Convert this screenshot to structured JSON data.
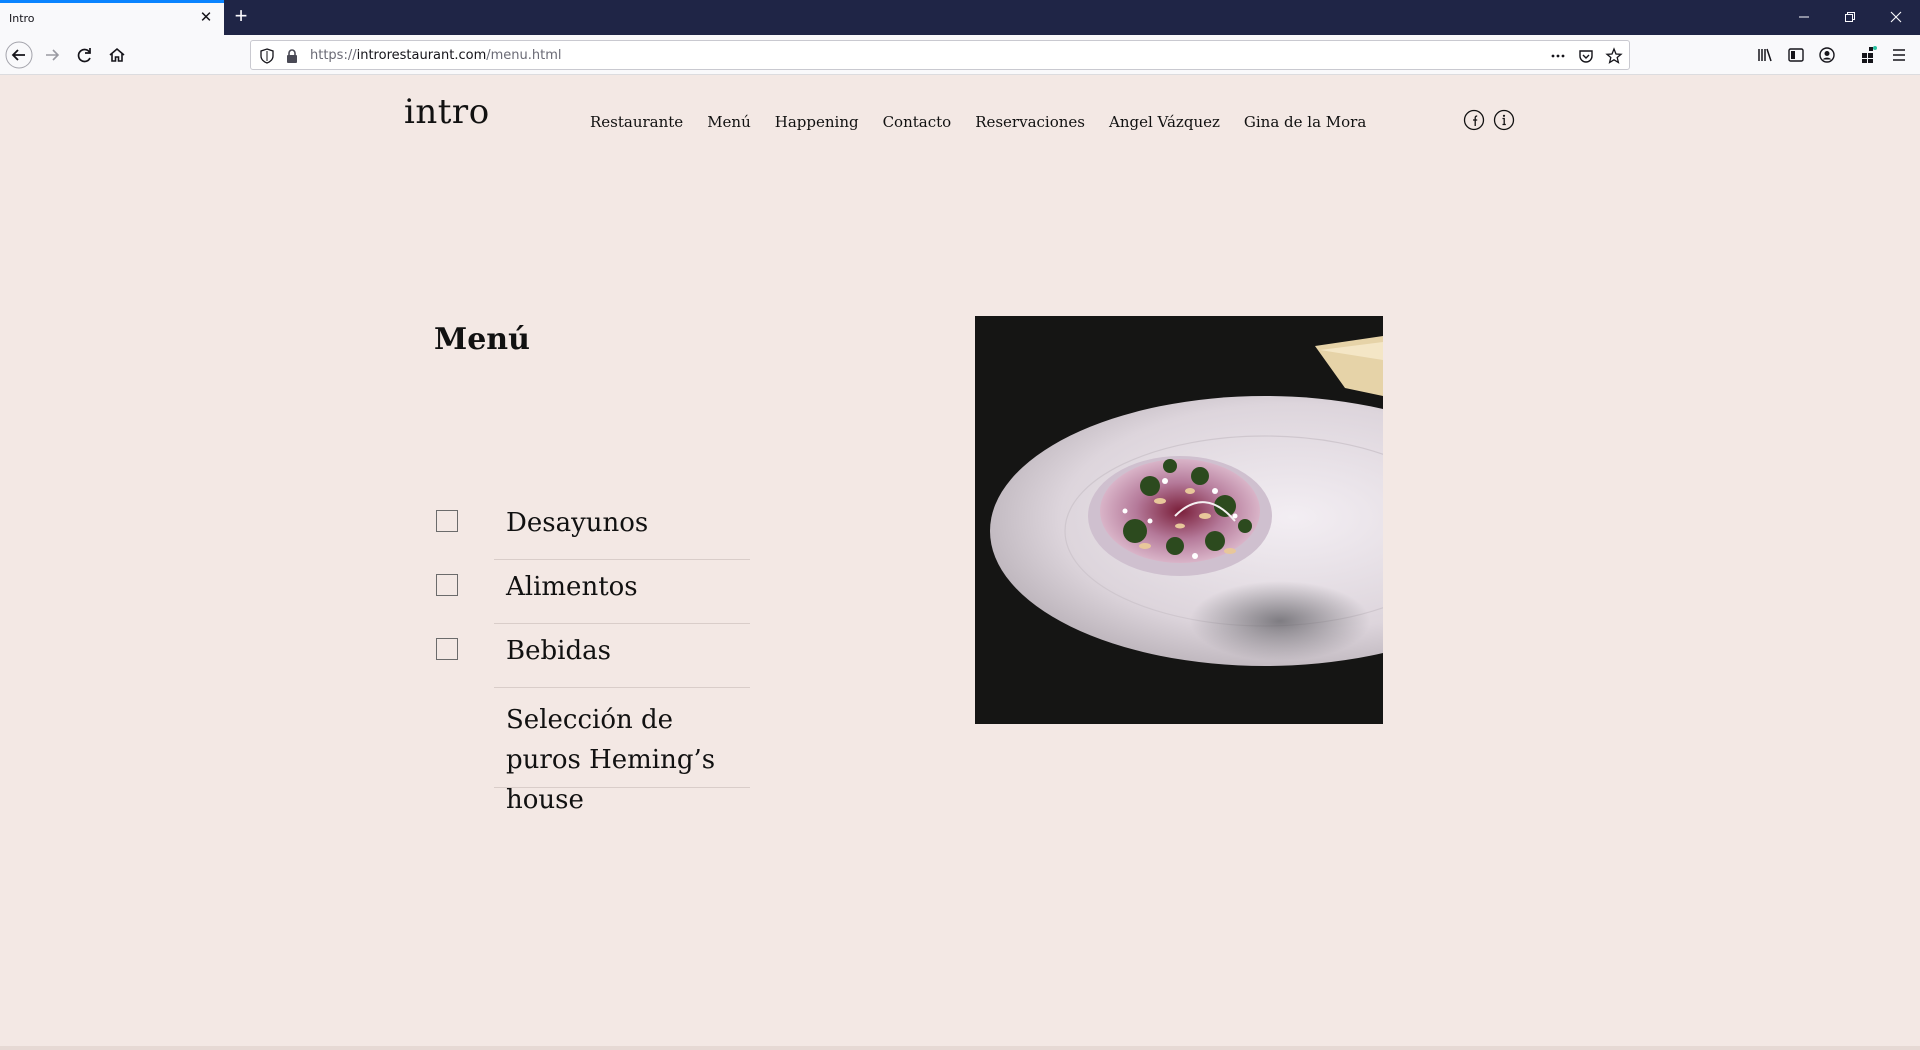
{
  "browser": {
    "tab_title": "Intro",
    "url_prefix": "https://",
    "url_host": "introrestaurant.com",
    "url_path": "/menu.html"
  },
  "site": {
    "logo": "intro",
    "nav": [
      "Restaurante",
      "Menú",
      "Happening",
      "Contacto",
      "Reservaciones",
      "Angel Vázquez",
      "Gina de la Mora"
    ],
    "social_icons": [
      "facebook-icon",
      "info-icon"
    ]
  },
  "menu": {
    "title": "Menú",
    "items": [
      {
        "label": "Desayunos",
        "has_checkbox": true
      },
      {
        "label": "Alimentos",
        "has_checkbox": true
      },
      {
        "label": "Bebidas",
        "has_checkbox": true
      },
      {
        "label": "Selección de puros Heming’s house",
        "has_checkbox": false
      }
    ]
  },
  "colors": {
    "page_bg": "#f3e8e4",
    "tabbar_bg": "#1f2546",
    "accent": "#0a84ff"
  }
}
